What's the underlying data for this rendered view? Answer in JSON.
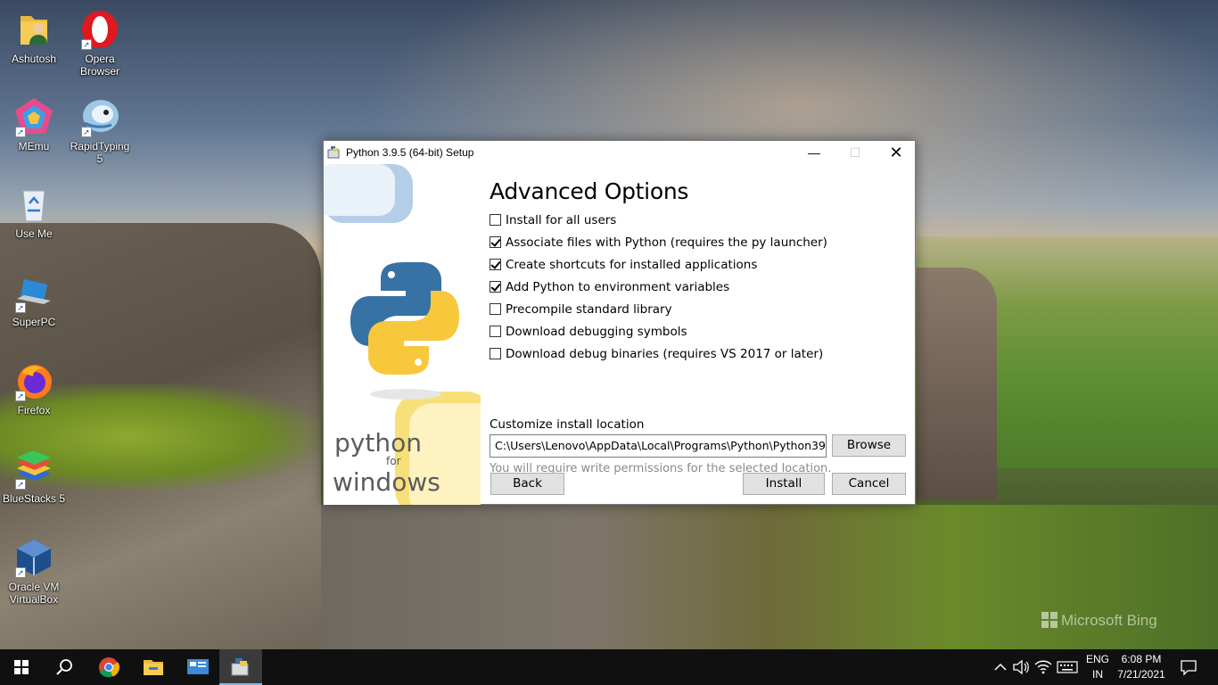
{
  "desktop": {
    "icons": [
      {
        "label": "Ashutosh"
      },
      {
        "label": "Opera Browser"
      },
      {
        "label": "MEmu"
      },
      {
        "label": "RapidTyping 5"
      },
      {
        "label": "Use Me"
      },
      {
        "label": "SuperPC"
      },
      {
        "label": "Firefox"
      },
      {
        "label": "BlueStacks 5"
      },
      {
        "label": "Oracle VM VirtualBox"
      }
    ],
    "watermark": "Microsoft Bing"
  },
  "window": {
    "title": "Python 3.9.5 (64-bit) Setup",
    "sidebar": {
      "brand_line1": "python",
      "brand_line2": "for",
      "brand_line3": "windows"
    },
    "heading": "Advanced Options",
    "options": [
      {
        "label": "Install for all users",
        "checked": false
      },
      {
        "label": "Associate files with Python (requires the py launcher)",
        "checked": true
      },
      {
        "label": "Create shortcuts for installed applications",
        "checked": true
      },
      {
        "label": "Add Python to environment variables",
        "checked": true
      },
      {
        "label": "Precompile standard library",
        "checked": false
      },
      {
        "label": "Download debugging symbols",
        "checked": false
      },
      {
        "label": "Download debug binaries (requires VS 2017 or later)",
        "checked": false
      }
    ],
    "location_label": "Customize install location",
    "location_value": "C:\\Users\\Lenovo\\AppData\\Local\\Programs\\Python\\Python39",
    "location_note": "You will require write permissions for the selected location.",
    "buttons": {
      "browse": "Browse",
      "back": "Back",
      "install": "Install",
      "cancel": "Cancel"
    }
  },
  "taskbar": {
    "lang_line1": "ENG",
    "lang_line2": "IN",
    "time": "6:08 PM",
    "date": "7/21/2021"
  }
}
